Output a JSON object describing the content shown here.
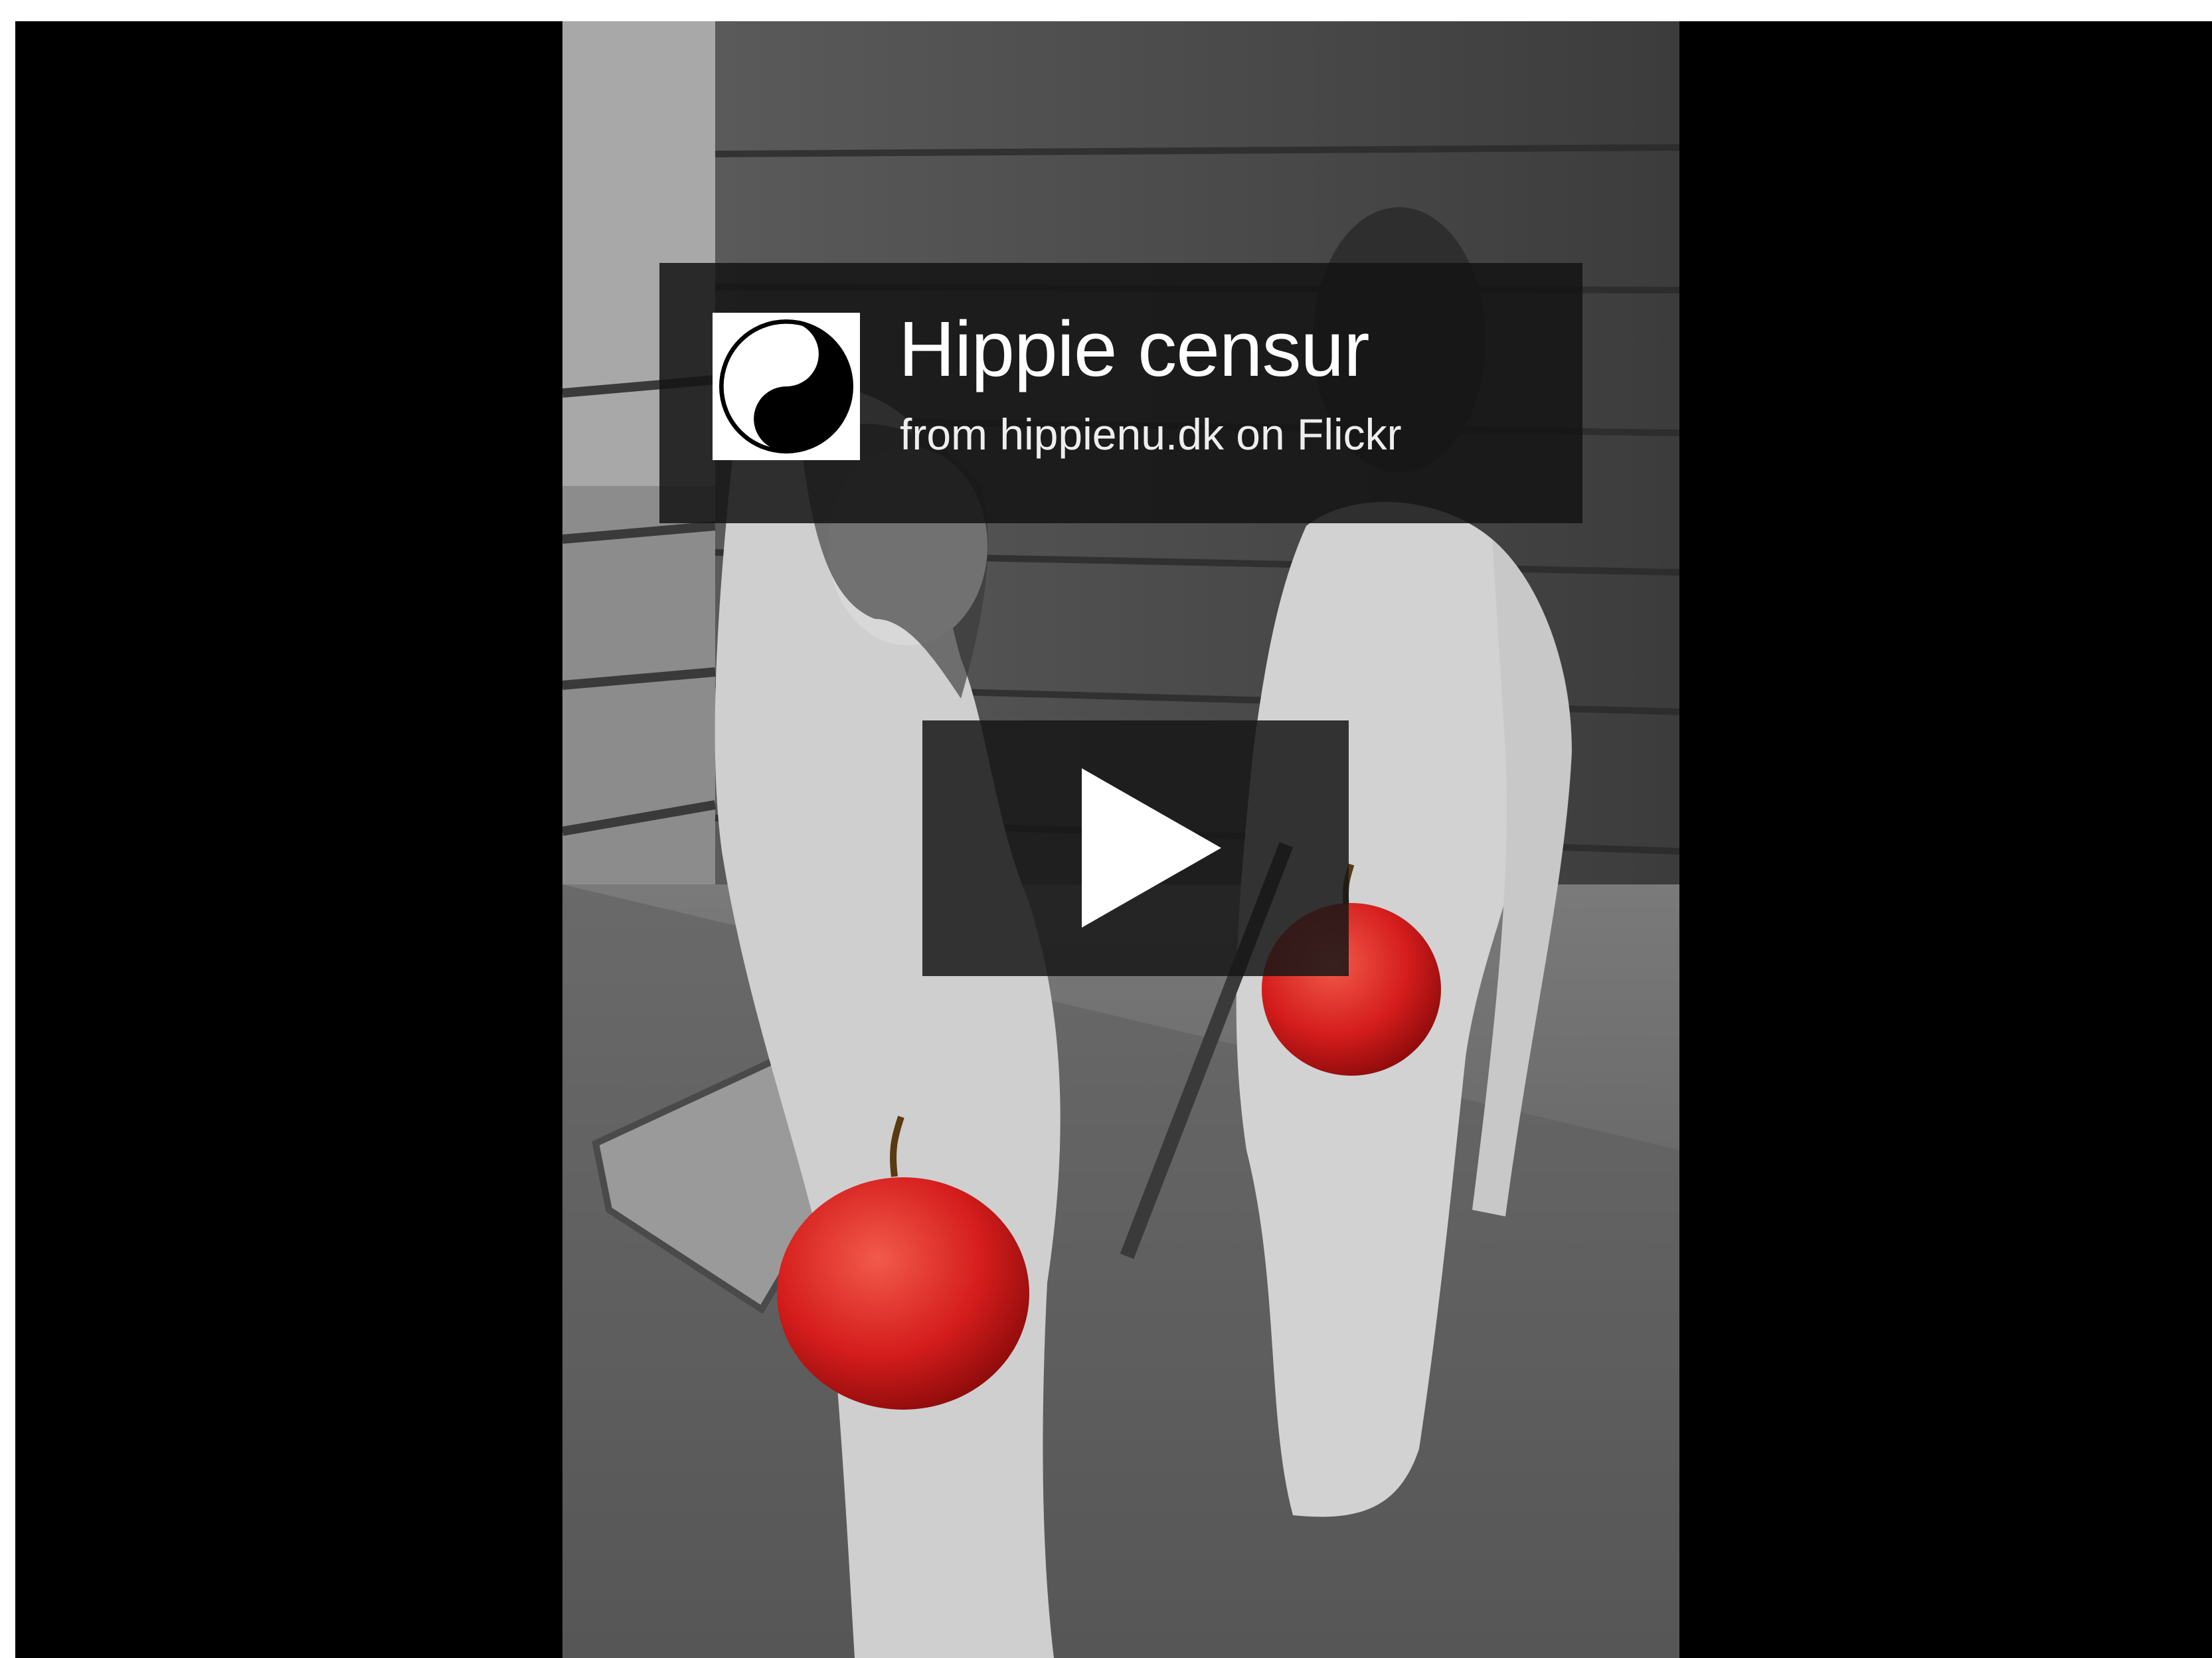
{
  "video": {
    "title": "Hippie censur",
    "subtitle": "from hippienu.dk on Flickr",
    "avatar_icon": "yin-yang-icon",
    "play_icon": "play-icon"
  },
  "colors": {
    "background": "#000000",
    "overlay": "#141414",
    "text": "#ffffff",
    "apple": "#d61a1a"
  }
}
